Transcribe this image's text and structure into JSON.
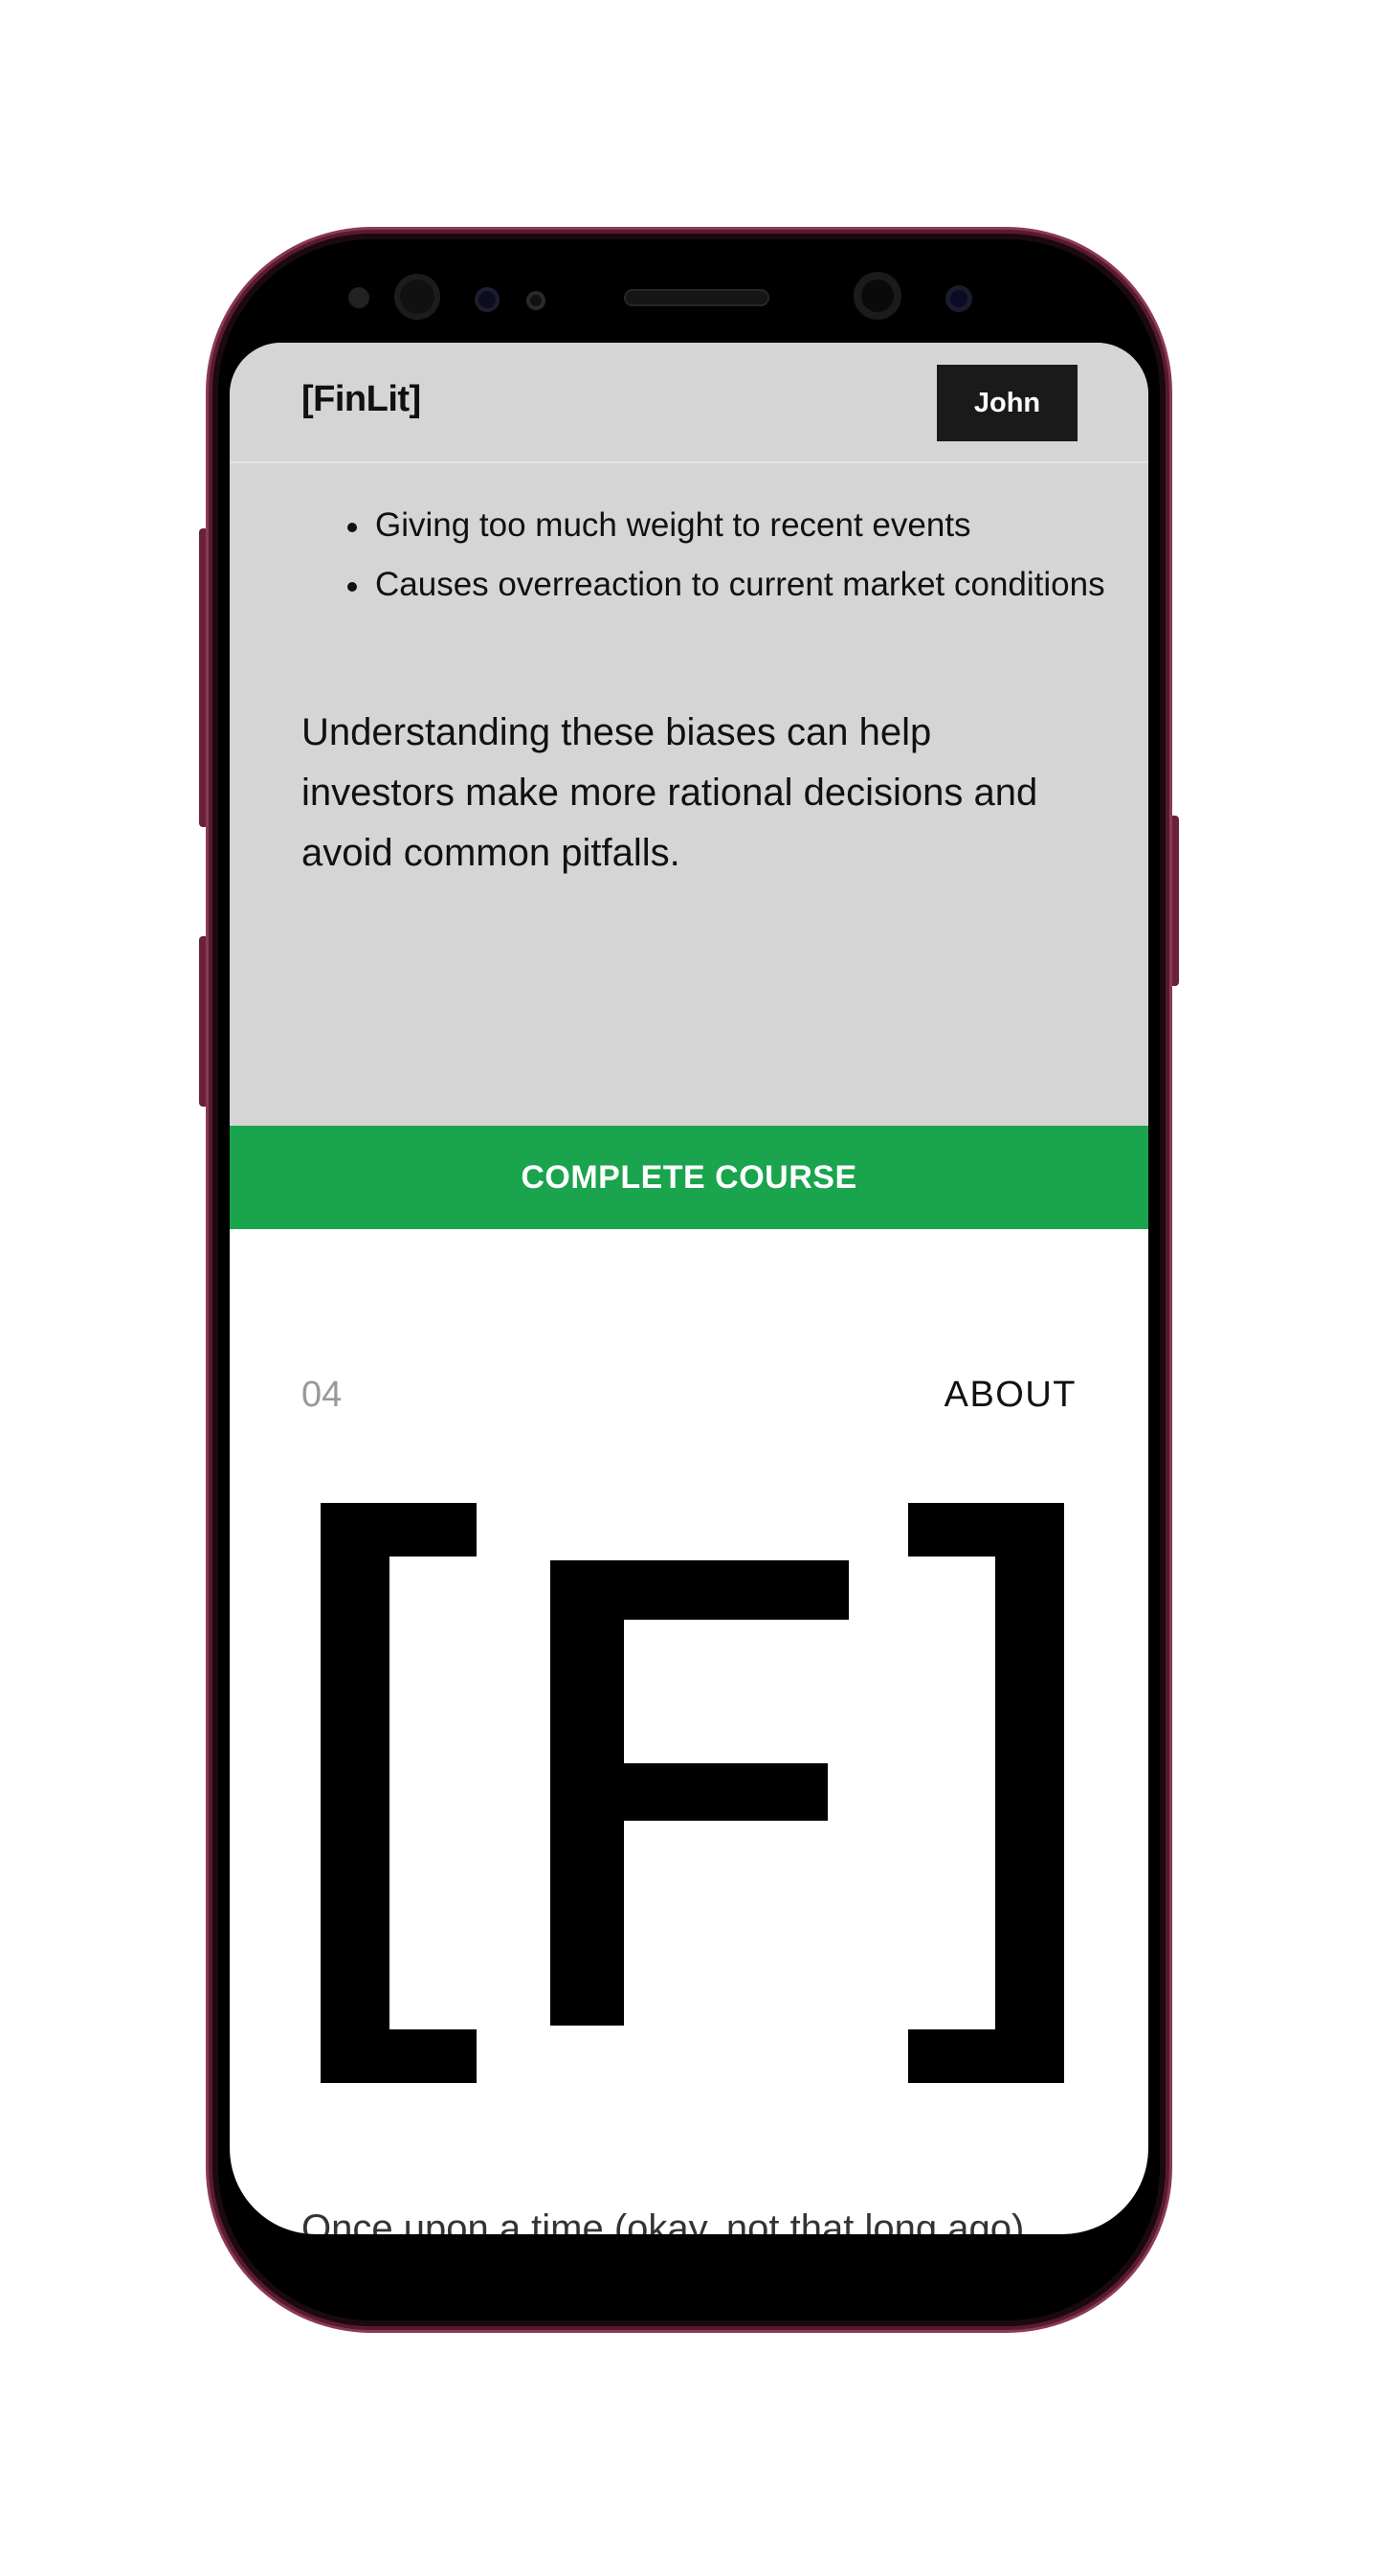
{
  "app": {
    "brand": "[FinLit]",
    "user_label": "John"
  },
  "lesson": {
    "bullets": [
      "Giving too much weight to recent events",
      "Causes overreaction to current market conditions"
    ],
    "summary": "Understanding these biases can help investors make more rational decisions and avoid common pitfalls.",
    "complete_label": "COMPLETE COURSE"
  },
  "about_section": {
    "number": "04",
    "title": "ABOUT",
    "logo_letter": "F",
    "story_text": "Once upon a time (okay, not that long ago)"
  },
  "colors": {
    "header_bg": "#d5d5d5",
    "accent_green": "#19a44d",
    "dark_button": "#1a1a1a",
    "phone_frame": "#5a1a2e"
  }
}
